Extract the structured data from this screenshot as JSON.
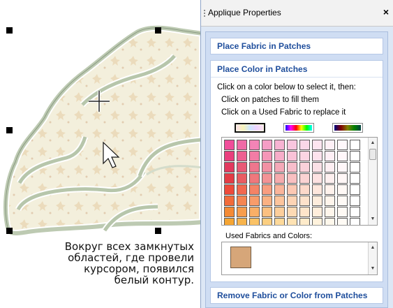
{
  "panel": {
    "title": "Applique Properties",
    "close_glyph": "×",
    "sections": {
      "place_fabric": "Place Fabric in Patches",
      "place_color": "Place Color in Patches",
      "remove": "Remove Fabric or Color from Patches"
    },
    "instructions": [
      "Click on a color below to select it, then:",
      "Click on patches to fill them",
      "Click on a Used Fabric to replace it"
    ],
    "palette_modes": [
      "pastel",
      "bright",
      "dark"
    ],
    "selected_mode": "pastel",
    "used_label": "Used Fabrics and Colors:",
    "used_colors": [
      "#d6a679"
    ]
  },
  "palette_rows": [
    [
      "#f04d9a",
      "#f06aa6",
      "#f384b6",
      "#f59dc5",
      "#f7b3d2",
      "#f9c6de",
      "#fbd7e8",
      "#fde5f0",
      "#fef0f6",
      "#fff8fb",
      "#ffffff"
    ],
    [
      "#ea3f7d",
      "#ee5f91",
      "#f27ca5",
      "#f596b8",
      "#f7adc9",
      "#f9c2d7",
      "#fbd4e3",
      "#fde3ed",
      "#feeff5",
      "#fff7fa",
      "#ffffff"
    ],
    [
      "#e33a5e",
      "#e95a76",
      "#ee768d",
      "#f291a4",
      "#f5a9b8",
      "#f8becb",
      "#fad1da",
      "#fce1e7",
      "#feeef2",
      "#fff7f9",
      "#ffffff"
    ],
    [
      "#e43c45",
      "#ea5c62",
      "#ef787c",
      "#f39396",
      "#f6abad",
      "#f9c0c1",
      "#fbd3d3",
      "#fde2e2",
      "#feefef",
      "#fff7f7",
      "#ffffff"
    ],
    [
      "#ee4a3a",
      "#f2684f",
      "#f58366",
      "#f89d80",
      "#fab49a",
      "#fcc8b3",
      "#fdd9ca",
      "#fee7dd",
      "#fff2ec",
      "#fff9f6",
      "#ffffff"
    ],
    [
      "#f26b3a",
      "#f58551",
      "#f89c6a",
      "#fab183",
      "#fcc49c",
      "#fdd4b5",
      "#fee2cb",
      "#feeddd",
      "#fff5ec",
      "#fffaf6",
      "#ffffff"
    ],
    [
      "#f48a34",
      "#f79d4d",
      "#f9af67",
      "#fbc081",
      "#fcce9b",
      "#fddab4",
      "#fee5ca",
      "#ffeedc",
      "#fff6ec",
      "#fffaf5",
      "#ffffff"
    ],
    [
      "#f5a533",
      "#f8b44c",
      "#fac266",
      "#fbce80",
      "#fdd99a",
      "#fee2b3",
      "#feebca",
      "#fff2dc",
      "#fff8ec",
      "#fffbf5",
      "#ffffff"
    ]
  ],
  "caption_lines": [
    "Вокруг всех замкнутых",
    "областей, где провели",
    "курсором, появился",
    "белый контур."
  ]
}
